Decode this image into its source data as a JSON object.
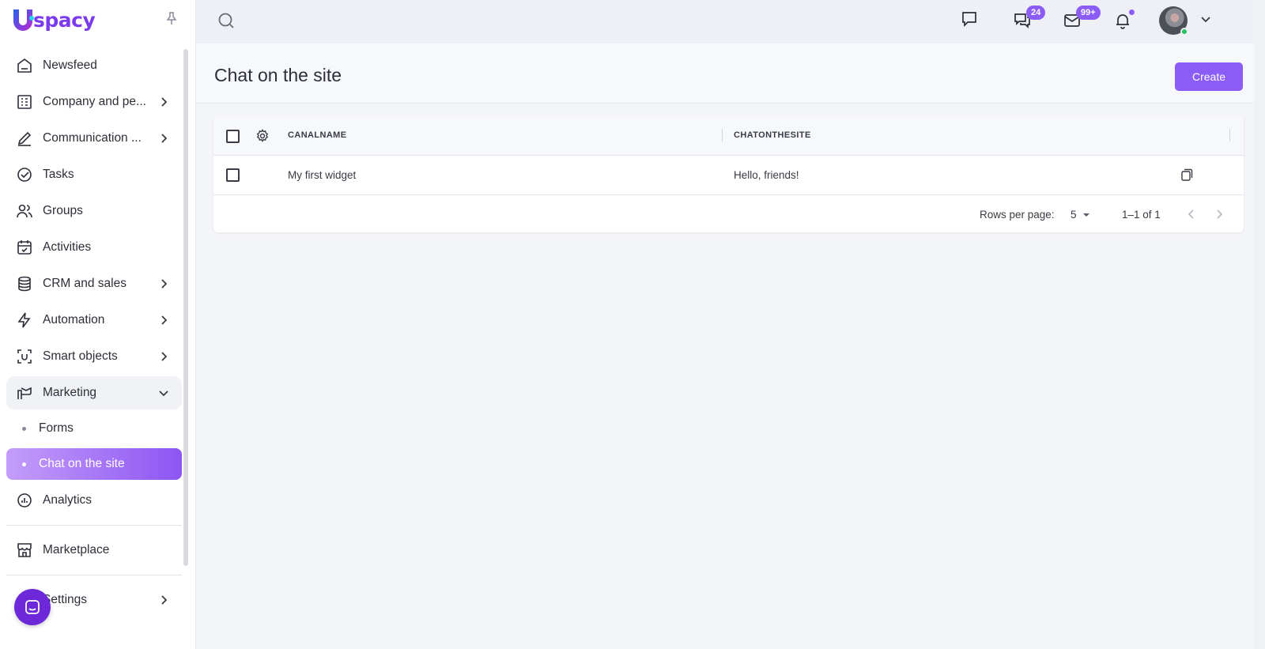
{
  "app": {
    "logo_text": "spacy",
    "logo_mark_letter": "U",
    "brand_color": "#8b5cf6"
  },
  "sidebar": {
    "items": [
      {
        "label": "Newsfeed",
        "icon": "home-icon"
      },
      {
        "label": "Company and pe...",
        "icon": "building-icon",
        "has_children": true
      },
      {
        "label": "Communication ...",
        "icon": "edit-icon",
        "has_children": true
      },
      {
        "label": "Tasks",
        "icon": "check-circle-icon"
      },
      {
        "label": "Groups",
        "icon": "users-icon"
      },
      {
        "label": "Activities",
        "icon": "calendar-icon"
      },
      {
        "label": "CRM and sales",
        "icon": "database-icon",
        "has_children": true
      },
      {
        "label": "Automation",
        "icon": "lightning-icon",
        "has_children": true
      },
      {
        "label": "Smart objects",
        "icon": "scan-icon",
        "has_children": true
      },
      {
        "label": "Marketing",
        "icon": "marketing-icon",
        "has_children": true,
        "expanded": true
      }
    ],
    "marketing_children": [
      {
        "label": "Forms"
      },
      {
        "label": "Chat on the site",
        "active": true
      }
    ],
    "after_items": [
      {
        "label": "Analytics",
        "icon": "analytics-icon"
      }
    ],
    "marketplace": {
      "label": "Marketplace",
      "icon": "store-icon"
    },
    "settings": {
      "label": "Settings",
      "icon": "gear-icon",
      "has_children": true
    }
  },
  "topbar": {
    "chat_badge": "24",
    "mail_badge": "99+"
  },
  "page": {
    "title": "Chat on the site",
    "create_label": "Create"
  },
  "table": {
    "columns": [
      "CANALNAME",
      "CHATONTHESITE"
    ],
    "rows": [
      {
        "canalname": "My first widget",
        "chatonthesite": "Hello, friends!"
      }
    ],
    "footer": {
      "rows_per_page_label": "Rows per page:",
      "rows_per_page_value": "5",
      "range": "1–1 of 1"
    }
  }
}
